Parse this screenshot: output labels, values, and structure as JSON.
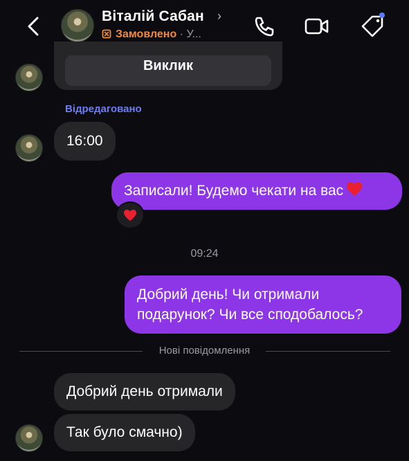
{
  "header": {
    "name": "Віталій Сабан",
    "order_status": "Замовлено",
    "status_suffix": "· У..."
  },
  "messages": {
    "call_label": "Виклик",
    "edited_label": "Відредаговано",
    "time_1600": "16:00",
    "recorded": "Записали! Будемо чекати на вас",
    "reaction": "❤️",
    "timestamp": "09:24",
    "good_day_q": "Добрий день! Чи отримали подарунок? Чи все сподобалось?",
    "new_messages_label": "Нові повідомлення",
    "reply_1": "Добрий день отримали",
    "reply_2": "Так було смачно)"
  },
  "colors": {
    "background": "#0c0c10",
    "incoming_bubble": "#262629",
    "outgoing_bubble": "#8d36e8",
    "accent_orange": "#f08a3d",
    "edited_blue": "#6c7df3"
  }
}
